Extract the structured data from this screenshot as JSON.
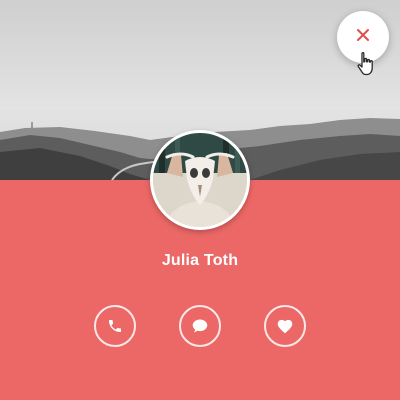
{
  "profile": {
    "name": "Julia Toth"
  },
  "icons": {
    "close": "close-icon",
    "call": "phone-icon",
    "message": "chat-bubble-icon",
    "like": "heart-icon",
    "cursor": "hand-pointer-icon"
  },
  "colors": {
    "accent": "#ec6867",
    "close_icon": "#e0504f",
    "text": "#ffffff"
  }
}
